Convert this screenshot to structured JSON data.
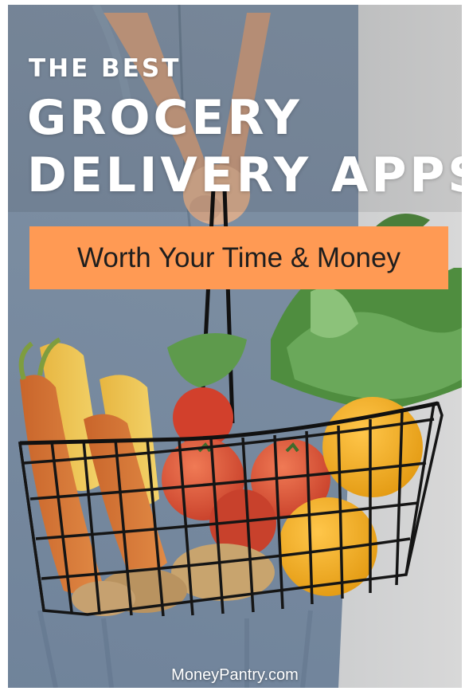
{
  "poster": {
    "kicker": "THE BEST",
    "title_line1": "GROCERY",
    "title_line2": "DELIVERY APPS",
    "banner_text": "Worth Your Time & Money",
    "site": "MoneyPantry.com"
  },
  "colors": {
    "banner": "#ff9a54",
    "title_text": "#ffffff",
    "banner_text": "#1e1e1e",
    "background": "#c9cbcc"
  }
}
